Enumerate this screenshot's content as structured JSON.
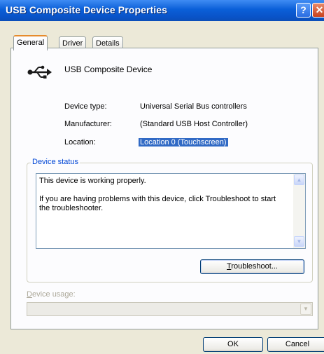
{
  "window": {
    "title": "USB Composite Device Properties",
    "help_glyph": "?",
    "close_glyph": "✕"
  },
  "tabs": [
    {
      "label": "General",
      "active": true
    },
    {
      "label": "Driver",
      "active": false
    },
    {
      "label": "Details",
      "active": false
    }
  ],
  "device": {
    "name": "USB Composite Device",
    "icon": "usb-icon",
    "properties": [
      {
        "label": "Device type:",
        "value": "Universal Serial Bus controllers"
      },
      {
        "label": "Manufacturer:",
        "value": "(Standard USB Host Controller)"
      },
      {
        "label": "Location:",
        "value": "Location 0 (Touchscreen)"
      }
    ]
  },
  "status": {
    "group_title": "Device status",
    "line1": "This device is working properly.",
    "line2": "If you are having problems with this device, click Troubleshoot to start the troubleshooter.",
    "troubleshoot_mnemonic": "T",
    "troubleshoot_rest": "roubleshoot..."
  },
  "usage": {
    "label_mnemonic": "D",
    "label_rest": "evice usage:",
    "value": ""
  },
  "footer": {
    "ok_label": "OK",
    "cancel_label": "Cancel"
  },
  "colors": {
    "title_bar": "#0a5fd8",
    "selection": "#316ac5",
    "group_title": "#0046d5",
    "active_tab_accent": "#e68b2c"
  }
}
